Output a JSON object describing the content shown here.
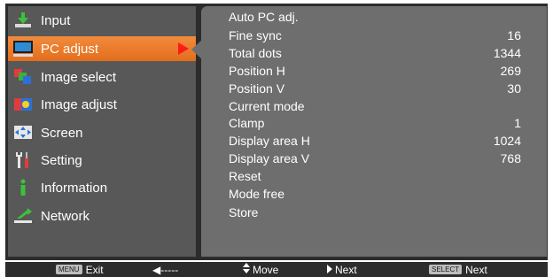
{
  "sidebar": {
    "items": [
      {
        "label": "Input",
        "icon": "input-icon"
      },
      {
        "label": "PC adjust",
        "icon": "pc-adjust-icon",
        "selected": true
      },
      {
        "label": "Image select",
        "icon": "image-select-icon"
      },
      {
        "label": "Image adjust",
        "icon": "image-adjust-icon"
      },
      {
        "label": "Screen",
        "icon": "screen-icon"
      },
      {
        "label": "Setting",
        "icon": "setting-icon"
      },
      {
        "label": "Information",
        "icon": "information-icon"
      },
      {
        "label": "Network",
        "icon": "network-icon"
      }
    ]
  },
  "panel": {
    "rows": [
      {
        "label": "Auto PC adj.",
        "value": ""
      },
      {
        "label": "Fine sync",
        "value": "16"
      },
      {
        "label": "Total dots",
        "value": "1344"
      },
      {
        "label": "Position H",
        "value": "269"
      },
      {
        "label": "Position V",
        "value": "30"
      },
      {
        "label": "Current mode",
        "value": ""
      },
      {
        "label": "Clamp",
        "value": "1"
      },
      {
        "label": "Display area H",
        "value": "1024"
      },
      {
        "label": "Display area V",
        "value": "768"
      },
      {
        "label": "Reset",
        "value": ""
      },
      {
        "label": "Mode free",
        "value": ""
      },
      {
        "label": "Store",
        "value": ""
      }
    ]
  },
  "footer": {
    "menu_key": "MENU",
    "exit_label": "Exit",
    "back_label": "◀-----",
    "move_label": "Move",
    "next_label": "Next",
    "select_key": "SELECT",
    "select_next_label": "Next"
  },
  "colors": {
    "selected": "#e36e1d",
    "arrow": "#ff1a1a",
    "sidebar_bg": "#585858",
    "panel_bg": "#6e6e6e"
  }
}
